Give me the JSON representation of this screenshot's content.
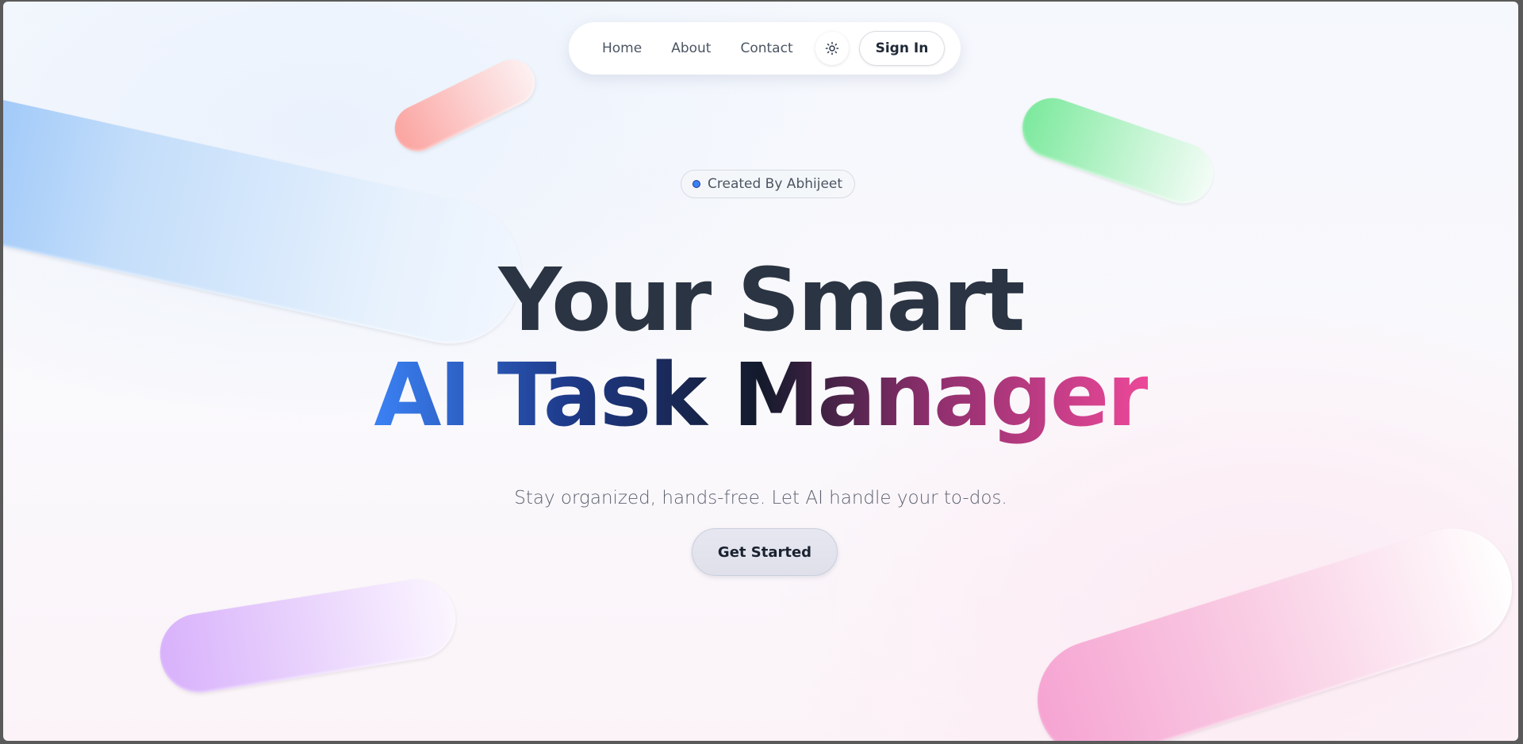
{
  "nav": {
    "links": [
      {
        "label": "Home"
      },
      {
        "label": "About"
      },
      {
        "label": "Contact"
      }
    ],
    "theme_toggle_icon": "sun-icon",
    "signin_label": "Sign In"
  },
  "hero": {
    "badge": "Created By Abhijeet",
    "headline_line1": "Your Smart",
    "headline_line2": "AI Task Manager",
    "subtitle": "Stay organized, hands-free. Let AI handle your to-dos.",
    "cta_label": "Get Started"
  },
  "colors": {
    "gradient_start": "#3b82f6",
    "gradient_mid": "#141a2c",
    "gradient_end": "#ec4899",
    "headline_dark": "#2b3442"
  }
}
